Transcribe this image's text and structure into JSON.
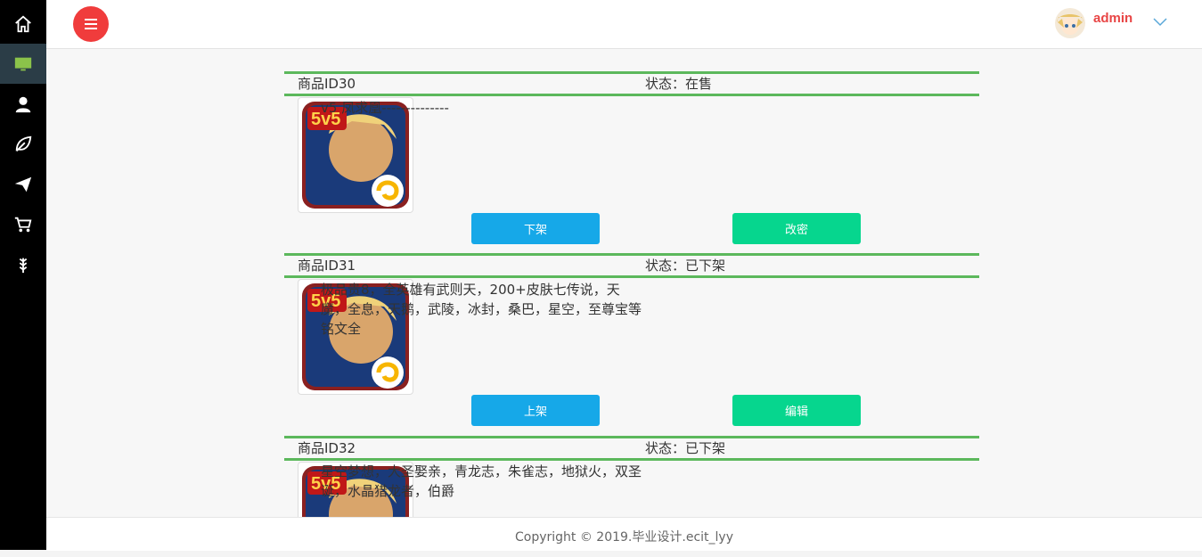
{
  "header": {
    "username": "admin"
  },
  "sidebar": {
    "items": [
      "home-icon",
      "monitor-icon",
      "user-icon",
      "leaf-icon",
      "send-icon",
      "cart-icon",
      "wheat-icon"
    ]
  },
  "products": [
    {
      "id": "商品ID30",
      "status": "状态：在售",
      "description": "v5 凤求凰--------------",
      "left_button": "下架",
      "right_button": "改密"
    },
    {
      "id": "商品ID31",
      "status": "状态：已下架",
      "description": "极品贵8，全英雄有武则天，200+皮肤七传说，天魔，全息，天鹅，武陵，冰封，桑巴，星空，至尊宝等铭文全",
      "left_button": "上架",
      "right_button": "编辑"
    },
    {
      "id": "商品ID32",
      "status": "状态：已下架",
      "description": "星空梦想，大圣娶亲，青龙志，朱雀志，地狱火，双圣诞，水晶猎龙者，伯爵"
    }
  ],
  "footer": {
    "copyright": "Copyright © 2019.毕业设计.ecit_lyy"
  },
  "colors": {
    "accent_red": "#f03c3c",
    "section_green": "#5cb85c",
    "button_blue": "#16a8e8",
    "button_green": "#06d68e"
  }
}
